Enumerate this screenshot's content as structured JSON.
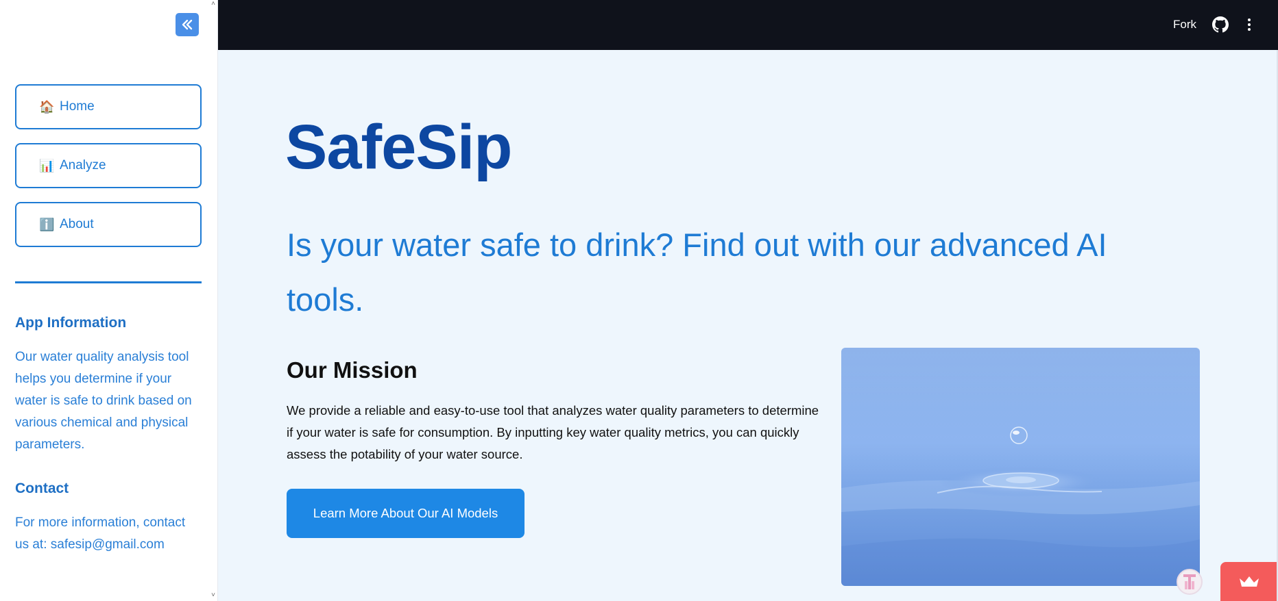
{
  "sidebar": {
    "nav": [
      {
        "label": "Home",
        "icon": "house-icon",
        "glyph": "🏠"
      },
      {
        "label": "Analyze",
        "icon": "bar-chart-icon",
        "glyph": "📊"
      },
      {
        "label": "About",
        "icon": "info-icon",
        "glyph": "ℹ️"
      }
    ],
    "app_info_heading": "App Information",
    "app_info_text": "Our water quality analysis tool helps you determine if your water is safe to drink based on various chemical and physical parameters.",
    "contact_heading": "Contact",
    "contact_text": "For more information, contact us at: safesip@gmail.com"
  },
  "header": {
    "fork_label": "Fork"
  },
  "main": {
    "title": "SafeSip",
    "tagline": "Is your water safe to drink? Find out with our advanced AI tools.",
    "mission_heading": "Our Mission",
    "mission_text": "We provide a reliable and easy-to-use tool that analyzes water quality parameters to determine if your water is safe for consumption. By inputting key water quality metrics, you can quickly assess the potability of your water source.",
    "cta_label": "Learn More About Our AI Models"
  },
  "colors": {
    "accent": "#1e7bd4",
    "title": "#0d47a1",
    "header_bg": "#0f121b",
    "page_bg": "#eef6fd",
    "cta_bg": "#1e88e5",
    "badge_red": "#f45b5b"
  }
}
